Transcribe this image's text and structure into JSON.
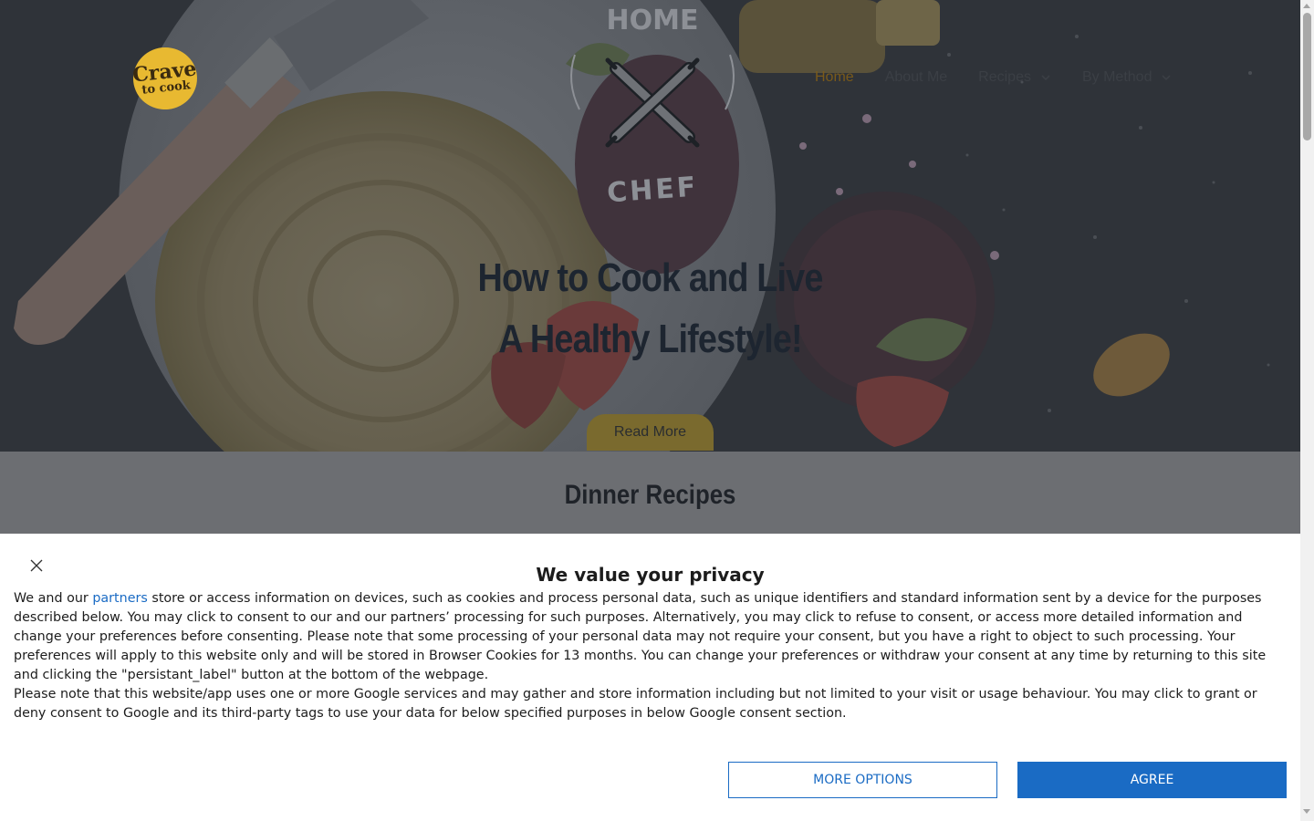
{
  "site": {
    "logo": {
      "line1": "Crave",
      "line2": "to cook"
    },
    "nav": [
      {
        "label": "Home",
        "has_dropdown": false,
        "active": true
      },
      {
        "label": "About Me",
        "has_dropdown": false,
        "active": false
      },
      {
        "label": "Recipes",
        "has_dropdown": true,
        "active": false
      },
      {
        "label": "By Method",
        "has_dropdown": true,
        "active": false
      }
    ],
    "emblem": {
      "top_text": "HOME",
      "bottom_text": "CHEF"
    },
    "hero": {
      "title_line1": "How to Cook and Live",
      "title_line2": "A Healthy Lifestyle!",
      "button_label": "Read More"
    },
    "section_title": "Dinner Recipes"
  },
  "consent": {
    "title": "We value your privacy",
    "para1_before_link": "We and our ",
    "partners_link": "partners",
    "para1_after_link": " store or access information on devices, such as cookies and process personal data, such as unique identifiers and standard information sent by a device for the purposes described below. You may click to consent to our and our partners’ processing for such purposes. Alternatively, you may click to refuse to consent, or access more detailed information and change your preferences before consenting. Please note that some processing of your personal data may not require your consent, but you have a right to object to such processing. Your preferences will apply to this website only and will be stored in Browser Cookies for 13 months. You can change your preferences or withdraw your consent at any time by returning to this site and clicking the \"persistant_label\" button at the bottom of the webpage.",
    "para2": "Please note that this website/app uses one or more Google services and may gather and store information including but not limited to your visit or usage behaviour. You may click to grant or deny consent to Google and its third-party tags to use your data for below specified purposes in below Google consent section.",
    "more_options_label": "MORE OPTIONS",
    "agree_label": "AGREE"
  },
  "colors": {
    "accent_blue": "#1a6bc4",
    "logo_yellow": "#e8b931",
    "overlay_dark": "#2d3238"
  },
  "icons": {
    "close": "close-icon",
    "dropdown": "chevron-down-icon",
    "emblem": "crossed-rolling-pins-icon"
  }
}
